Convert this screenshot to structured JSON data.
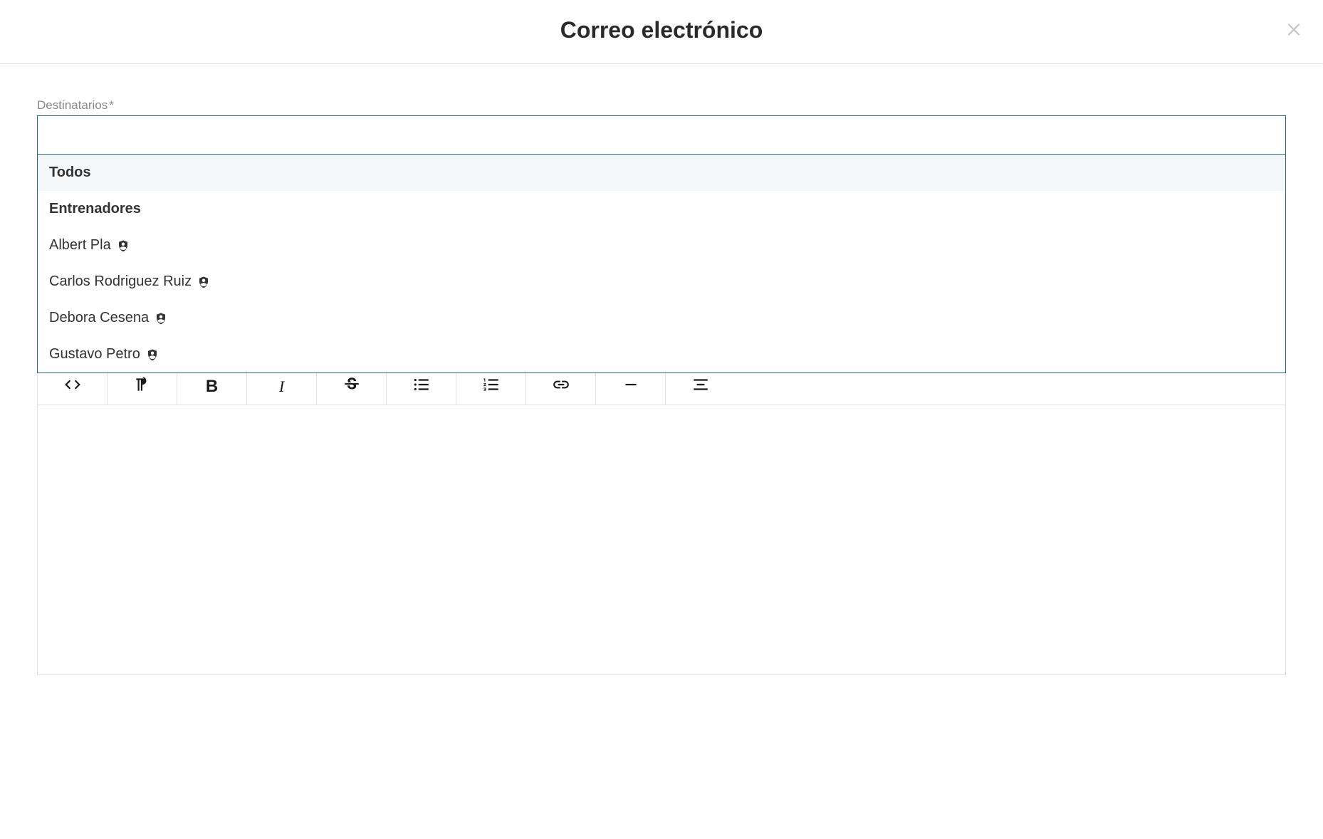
{
  "modal": {
    "title": "Correo electrónico"
  },
  "recipients": {
    "label": "Destinatarios",
    "required_mark": "*",
    "input_value": "",
    "options": {
      "all": "Todos",
      "group_header": "Entrenadores",
      "people": [
        {
          "name": "Albert Pla"
        },
        {
          "name": "Carlos Rodriguez Ruiz"
        },
        {
          "name": "Debora Cesena"
        },
        {
          "name": "Gustavo Petro"
        }
      ]
    }
  },
  "toolbar": {
    "code_view": "< >",
    "bold": "B",
    "italic": "I",
    "strike": "S"
  }
}
